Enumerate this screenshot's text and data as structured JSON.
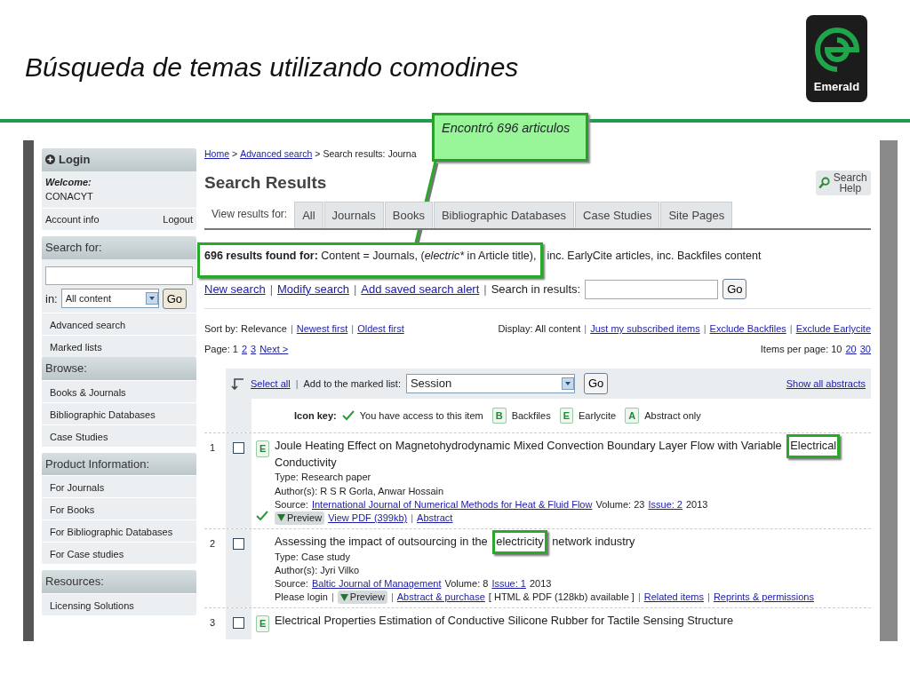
{
  "slide": {
    "title": "Búsqueda de temas utilizando comodines",
    "logo_text": "Emerald"
  },
  "callout": {
    "text": "Encontró 696 articulos"
  },
  "sidebar": {
    "login": {
      "title": "Login",
      "welcome": "Welcome:",
      "user": "CONACYT",
      "account": "Account info",
      "logout": "Logout"
    },
    "search": {
      "title": "Search for:",
      "in_label": "in:",
      "scope": "All content",
      "go": "Go",
      "links": [
        "Advanced search",
        "Marked lists"
      ]
    },
    "sections": [
      {
        "title": "Browse:",
        "items": [
          "Books & Journals",
          "Bibliographic Databases",
          "Case Studies"
        ]
      },
      {
        "title": "Product Information:",
        "items": [
          "For Journals",
          "For Books",
          "For Bibliographic Databases",
          "For Case studies"
        ]
      },
      {
        "title": "Resources:",
        "items": [
          "Licensing Solutions"
        ]
      }
    ]
  },
  "main": {
    "breadcrumb": [
      {
        "kind": "link",
        "text": "Home"
      },
      {
        "kind": "text",
        "text": ">"
      },
      {
        "kind": "link",
        "text": "Advanced search"
      },
      {
        "kind": "text",
        "text": ">"
      },
      {
        "kind": "text",
        "text": "Search results: Journa"
      }
    ],
    "heading": "Search Results",
    "help_button": "Search Help",
    "tabs_label": "View results for:",
    "tabs": [
      {
        "label": "All",
        "selected": false
      },
      {
        "label": "Journals",
        "selected": false
      },
      {
        "label": "Books",
        "selected": false
      },
      {
        "label": "Bibliographic Databases",
        "selected": false
      },
      {
        "label": "Case Studies",
        "selected": false
      },
      {
        "label": "Site Pages",
        "selected": false
      }
    ],
    "summary": {
      "highlighted": [
        {
          "kind": "strong",
          "text": "696 results found for:"
        },
        {
          "kind": "plain",
          "text": " Content = Journals, ("
        },
        {
          "kind": "emphasis",
          "text": "electric*"
        },
        {
          "kind": "plain",
          "text": " in Article title),"
        }
      ],
      "rest": "inc. EarlyCite articles, inc. Backfiles content"
    },
    "actions": [
      {
        "kind": "link",
        "text": "New search"
      },
      {
        "kind": "sep",
        "text": "|"
      },
      {
        "kind": "link",
        "text": "Modify search"
      },
      {
        "kind": "sep",
        "text": "|"
      },
      {
        "kind": "link",
        "text": "Add saved search alert"
      },
      {
        "kind": "sep",
        "text": "|"
      },
      {
        "kind": "text",
        "text": "Search in results:"
      }
    ],
    "search_in_results": {
      "go": "Go"
    },
    "sort": [
      {
        "kind": "text",
        "text": "Sort by: Relevance"
      },
      {
        "kind": "sep",
        "text": "|"
      },
      {
        "kind": "link",
        "text": "Newest first"
      },
      {
        "kind": "sep",
        "text": "|"
      },
      {
        "kind": "link",
        "text": "Oldest first"
      }
    ],
    "display": [
      {
        "kind": "text",
        "text": "Display: All content"
      },
      {
        "kind": "sep",
        "text": "|"
      },
      {
        "kind": "link",
        "text": "Just my subscribed items"
      },
      {
        "kind": "sep",
        "text": "|"
      },
      {
        "kind": "link",
        "text": "Exclude Backfiles"
      },
      {
        "kind": "sep",
        "text": "|"
      },
      {
        "kind": "link",
        "text": "Exclude Earlycite"
      }
    ],
    "pages": [
      {
        "kind": "text",
        "text": "Page: 1"
      },
      {
        "kind": "link",
        "text": "2"
      },
      {
        "kind": "link",
        "text": "3"
      },
      {
        "kind": "link",
        "text": "Next >"
      }
    ],
    "per_page": [
      {
        "kind": "text",
        "text": "Items per page: 10"
      },
      {
        "kind": "link",
        "text": "20"
      },
      {
        "kind": "link",
        "text": "30"
      }
    ],
    "toolbar": {
      "select_all": "Select all",
      "sep": "|",
      "add_label": "Add to the marked list:",
      "list": "Session",
      "go": "Go",
      "show_abstracts": "Show all abstracts"
    },
    "icon_key": {
      "label": "Icon key:",
      "access": "You have access to this item",
      "badges": [
        {
          "letter": "B",
          "text": "Backfiles"
        },
        {
          "letter": "E",
          "text": "Earlycite"
        },
        {
          "letter": "A",
          "text": "Abstract only"
        }
      ]
    },
    "results": [
      {
        "number": "1",
        "checked": false,
        "badge": "E",
        "access": true,
        "title": [
          {
            "text": "Joule Heating Effect on Magnetohydrodynamic Mixed Convection Boundary Layer Flow with Variable"
          },
          {
            "text": "Electrical",
            "highlight": true
          },
          {
            "text": "Conductivity"
          }
        ],
        "type": "Type: Research paper",
        "authors": "Author(s): R S R Gorla, Anwar Hossain",
        "source": [
          {
            "kind": "text",
            "text": "Source:"
          },
          {
            "kind": "link",
            "text": "International Journal of Numerical Methods for Heat & Fluid Flow"
          },
          {
            "kind": "text",
            "text": "Volume: 23"
          },
          {
            "kind": "link",
            "text": "Issue: 2"
          },
          {
            "kind": "text",
            "text": "2013"
          }
        ],
        "links": [
          {
            "kind": "button",
            "text": "Preview"
          },
          {
            "kind": "link",
            "text": "View PDF (399kb)"
          },
          {
            "kind": "sep",
            "text": "|"
          },
          {
            "kind": "link",
            "text": "Abstract"
          }
        ]
      },
      {
        "number": "2",
        "checked": false,
        "title": [
          {
            "text": "Assessing the impact of outsourcing in the"
          },
          {
            "text": "electricity",
            "highlight": true
          },
          {
            "text": "network industry"
          }
        ],
        "type": "Type: Case study",
        "authors": "Author(s): Jyri Vilko",
        "source": [
          {
            "kind": "text",
            "text": "Source:"
          },
          {
            "kind": "link",
            "text": "Baltic Journal of Management"
          },
          {
            "kind": "text",
            "text": "Volume: 8"
          },
          {
            "kind": "link",
            "text": "Issue: 1"
          },
          {
            "kind": "text",
            "text": "2013"
          }
        ],
        "links": [
          {
            "kind": "text",
            "text": "Please login"
          },
          {
            "kind": "sep",
            "text": "|"
          },
          {
            "kind": "button",
            "text": "Preview"
          },
          {
            "kind": "sep",
            "text": "|"
          },
          {
            "kind": "link",
            "text": "Abstract & purchase"
          },
          {
            "kind": "text",
            "text": "[ HTML & PDF (128kb) available ]"
          },
          {
            "kind": "sep",
            "text": "|"
          },
          {
            "kind": "link",
            "text": "Related items"
          },
          {
            "kind": "sep",
            "text": "|"
          },
          {
            "kind": "link",
            "text": "Reprints & permissions"
          }
        ]
      },
      {
        "number": "3",
        "checked": false,
        "badge": "E",
        "title": [
          {
            "text": "Electrical Properties Estimation of Conductive Silicone Rubber for Tactile Sensing Structure"
          }
        ]
      }
    ]
  }
}
